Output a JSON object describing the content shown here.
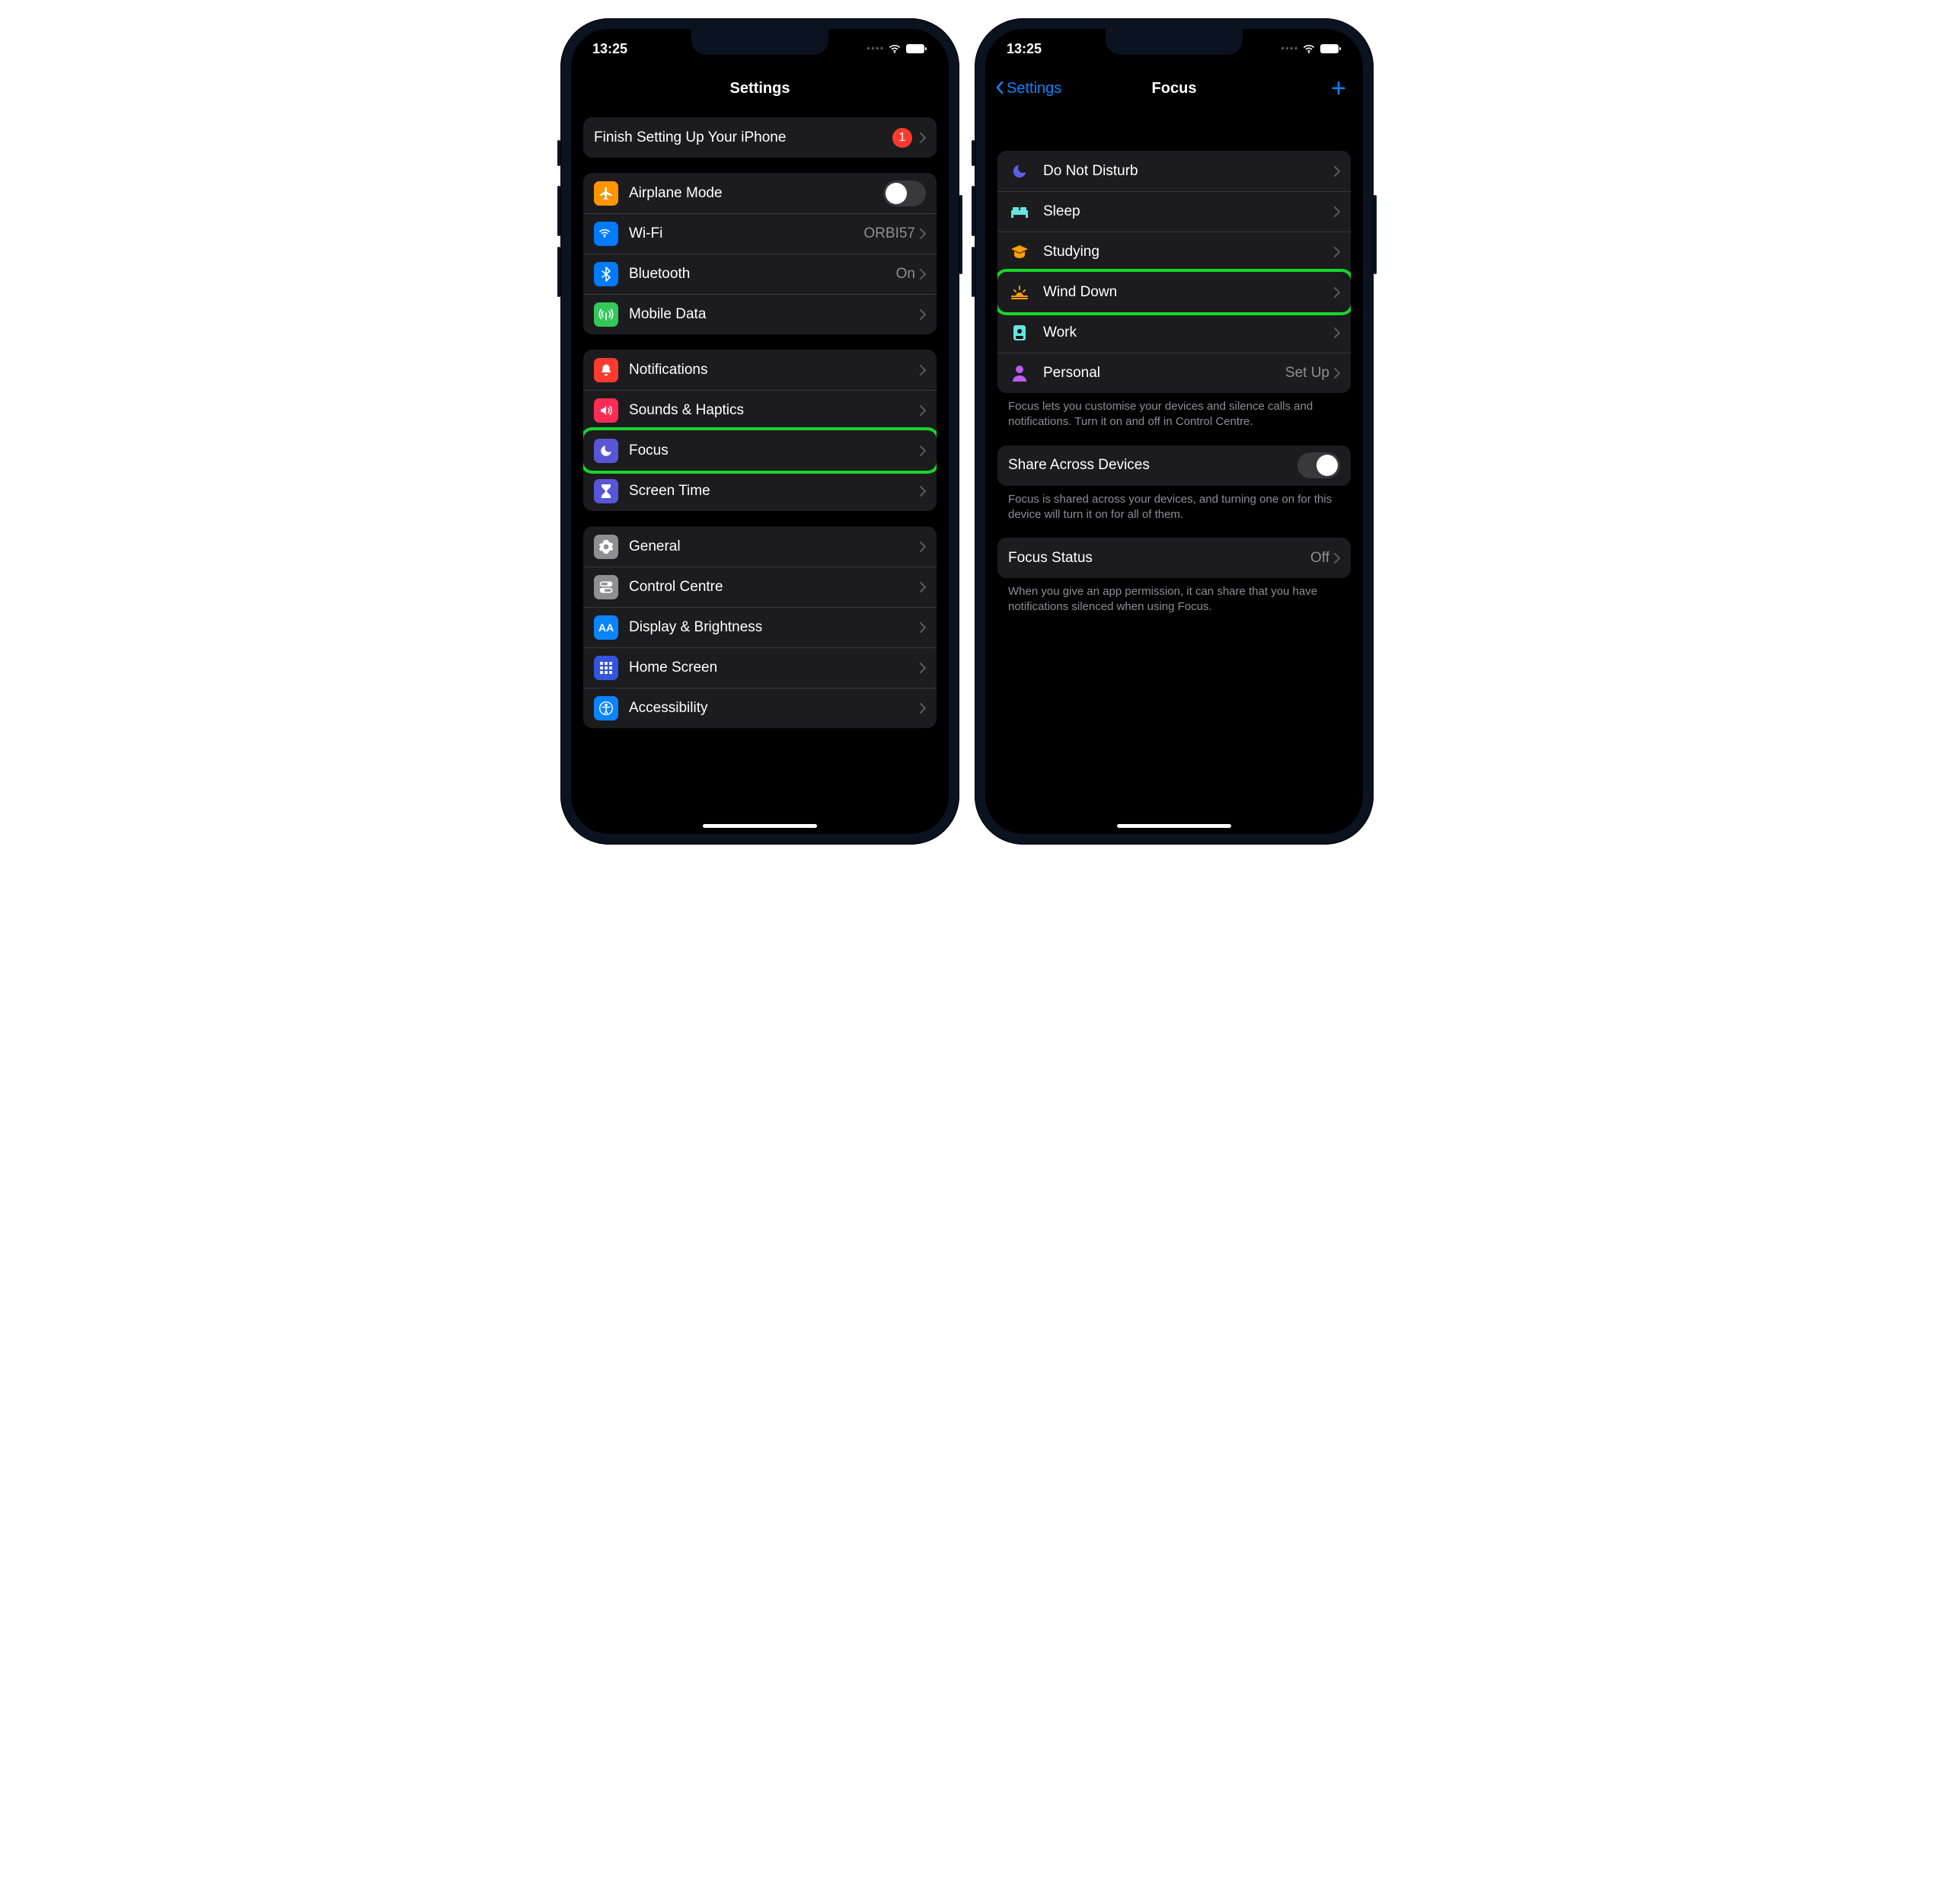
{
  "status": {
    "time": "13:25"
  },
  "left": {
    "title": "Settings",
    "finish": {
      "label": "Finish Setting Up Your iPhone",
      "badge": "1"
    },
    "g1": {
      "airplane": "Airplane Mode",
      "wifi": "Wi-Fi",
      "wifi_value": "ORBI57",
      "bluetooth": "Bluetooth",
      "bluetooth_value": "On",
      "mobile": "Mobile Data"
    },
    "g2": {
      "notifications": "Notifications",
      "sounds": "Sounds & Haptics",
      "focus": "Focus",
      "screentime": "Screen Time"
    },
    "g3": {
      "general": "General",
      "control": "Control Centre",
      "display": "Display & Brightness",
      "home": "Home Screen",
      "access": "Accessibility"
    }
  },
  "right": {
    "back": "Settings",
    "title": "Focus",
    "modes": {
      "dnd": "Do Not Disturb",
      "sleep": "Sleep",
      "study": "Studying",
      "wind": "Wind Down",
      "work": "Work",
      "personal": "Personal",
      "personal_value": "Set Up"
    },
    "modes_footer": "Focus lets you customise your devices and silence calls and notifications. Turn it on and off in Control Centre.",
    "share": {
      "label": "Share Across Devices"
    },
    "share_footer": "Focus is shared across your devices, and turning one on for this device will turn it on for all of them.",
    "status_row": {
      "label": "Focus Status",
      "value": "Off"
    },
    "status_footer": "When you give an app permission, it can share that you have notifications silenced when using Focus."
  }
}
